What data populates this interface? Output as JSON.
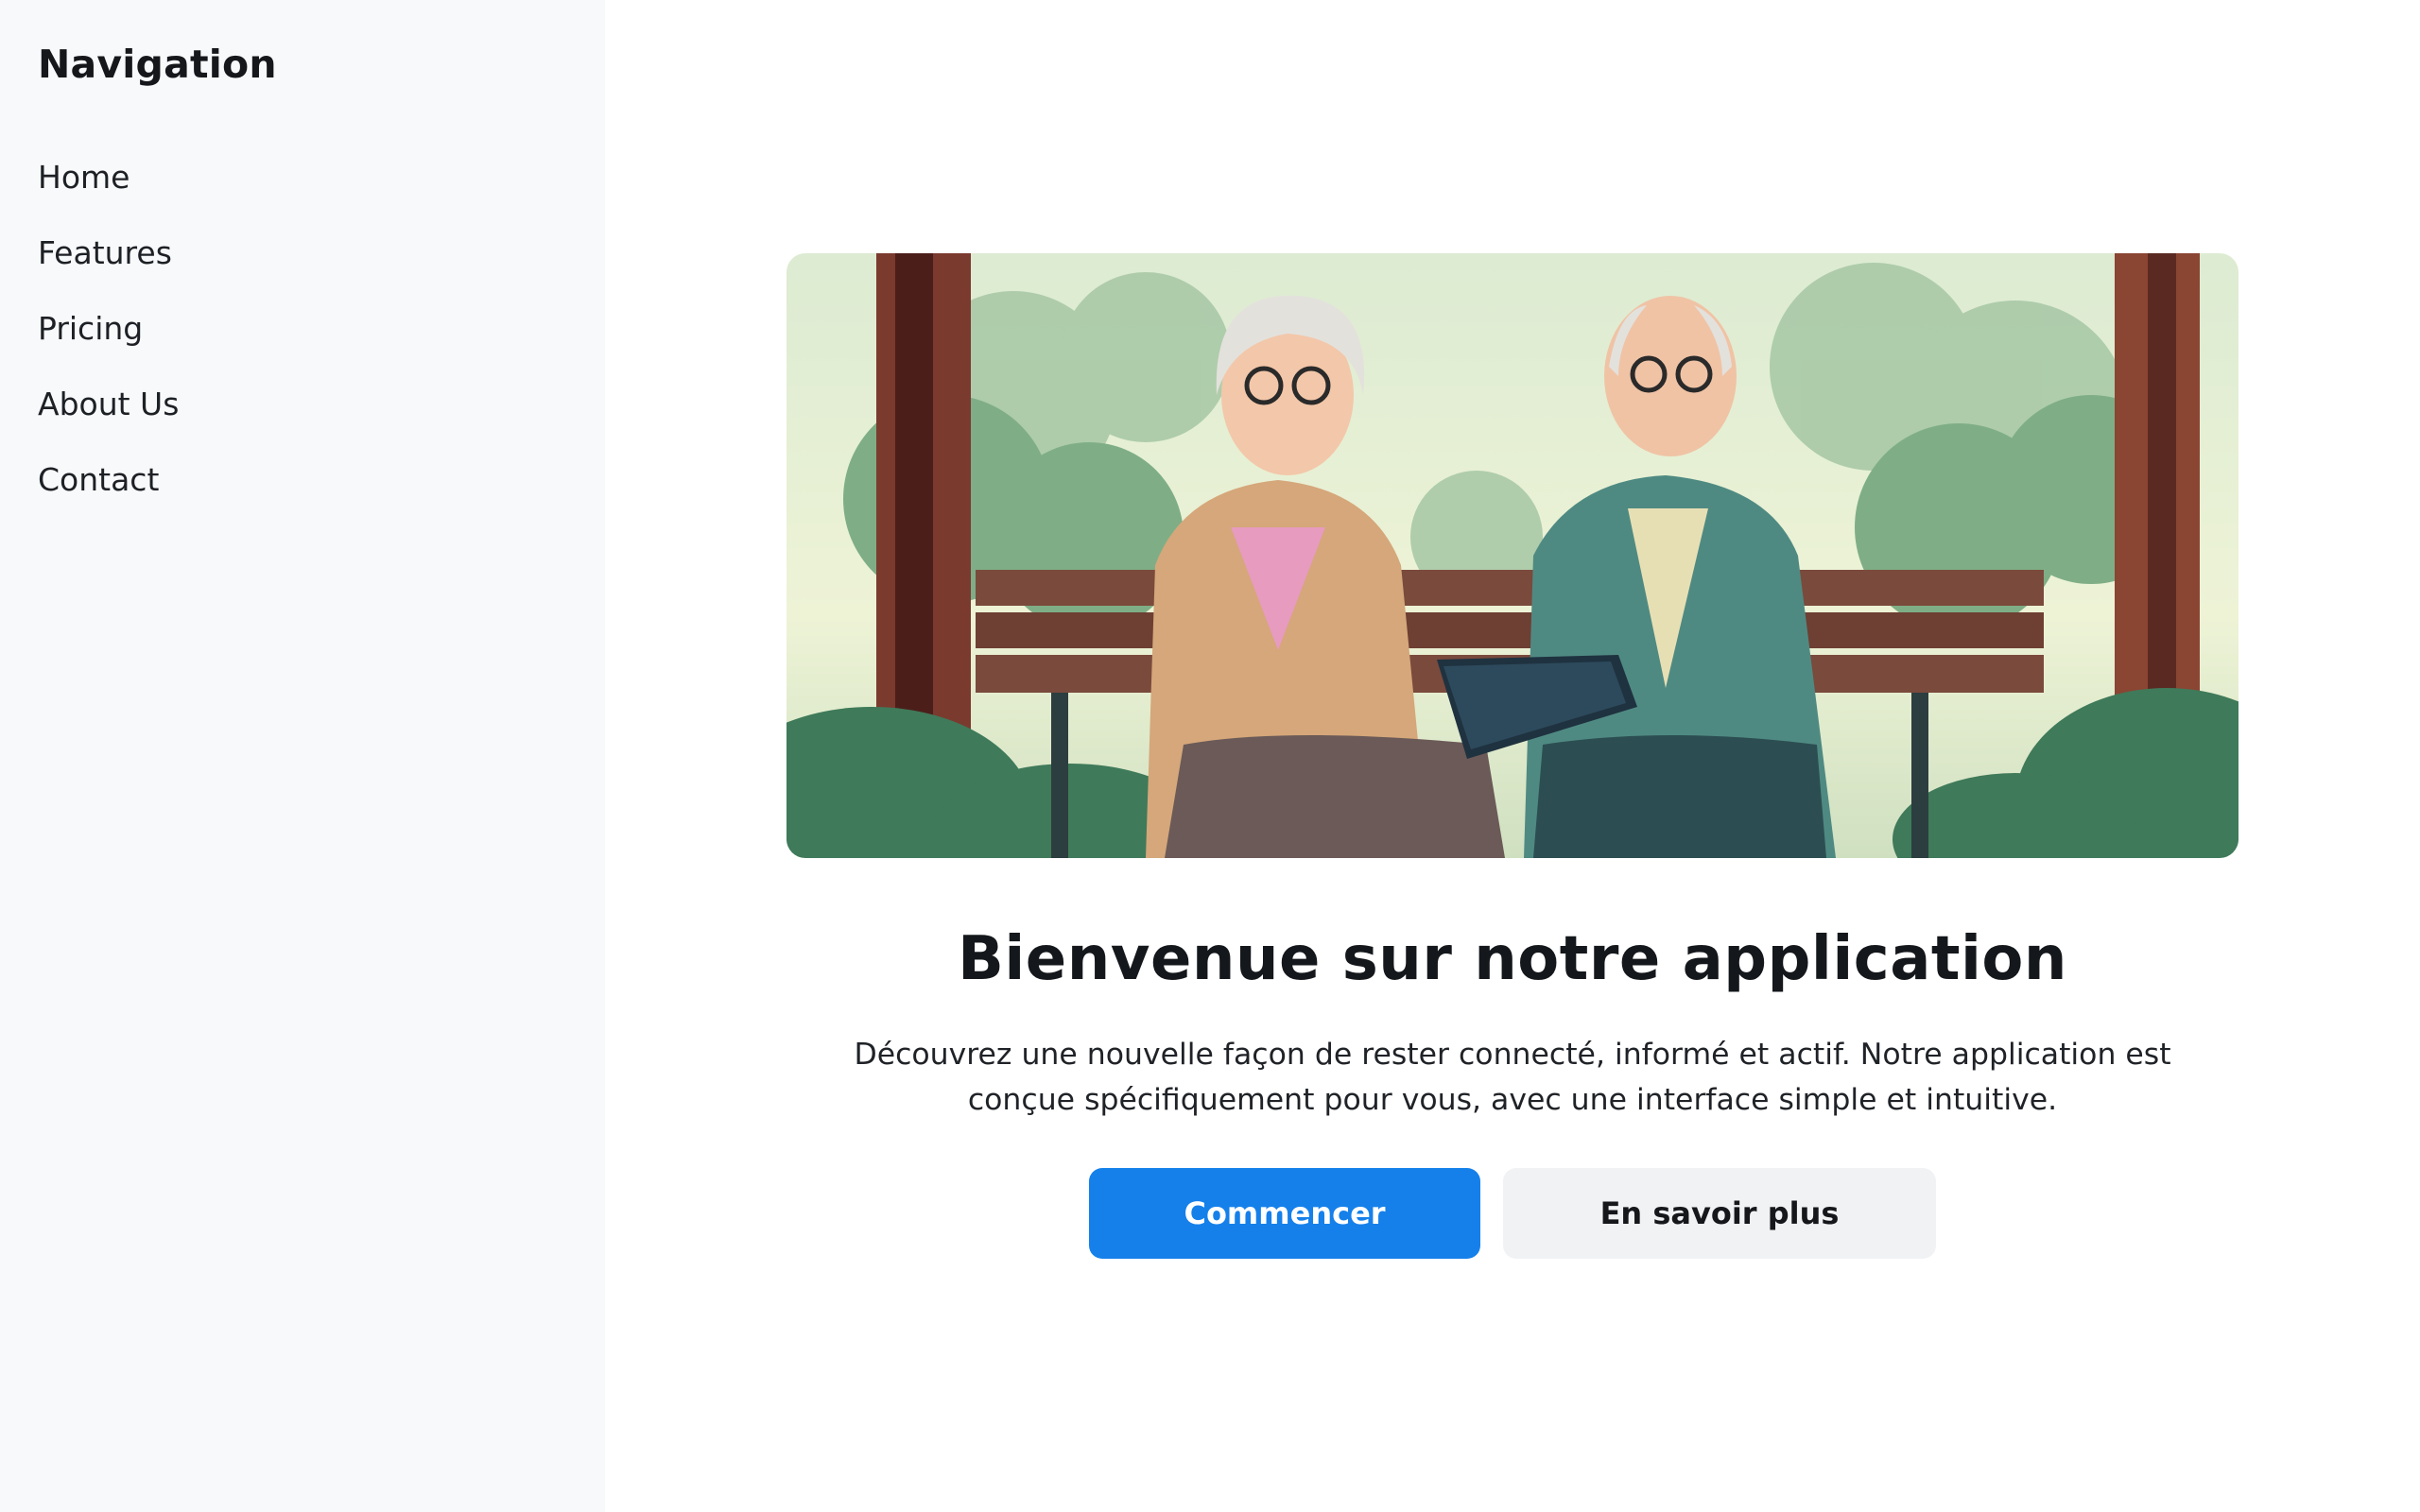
{
  "sidebar": {
    "title": "Navigation",
    "items": [
      {
        "label": "Home"
      },
      {
        "label": "Features"
      },
      {
        "label": "Pricing"
      },
      {
        "label": "About Us"
      },
      {
        "label": "Contact"
      }
    ]
  },
  "hero": {
    "image_icon": "illustration-elderly-couple-tablet-park-bench",
    "title": "Bienvenue sur notre application",
    "description": "Découvrez une nouvelle façon de rester connecté, informé et actif. Notre application est conçue spécifiquement pour vous, avec une interface simple et intuitive.",
    "primary_button": "Commencer",
    "secondary_button": "En savoir plus"
  },
  "colors": {
    "sidebar_bg": "#f8f9fb",
    "primary": "#1580ea",
    "secondary_bg": "#f0f2f4",
    "text": "#111418"
  }
}
